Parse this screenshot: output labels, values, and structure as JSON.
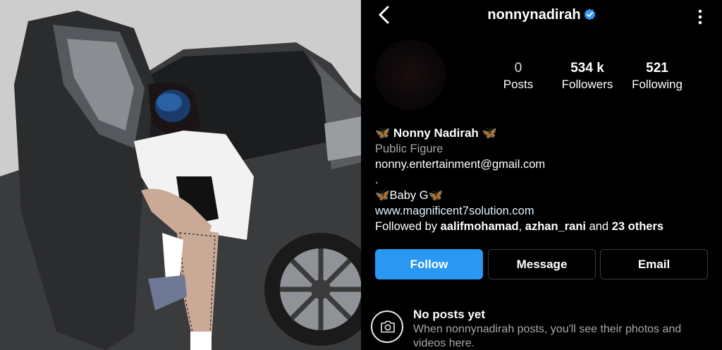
{
  "header": {
    "username": "nonnynadirah",
    "back_icon": "chevron-left-icon",
    "verified_icon": "verified-badge-icon",
    "more_icon": "more-vertical-icon"
  },
  "stats": {
    "posts": {
      "value": "0",
      "label": "Posts"
    },
    "followers": {
      "value": "534 k",
      "label": "Followers"
    },
    "following": {
      "value": "521",
      "label": "Following"
    }
  },
  "bio": {
    "name": "Nonny Nadirah",
    "name_emoji": "🦋",
    "category": "Public Figure",
    "email": "nonny.entertainment@gmail.com",
    "dot": ".",
    "baby_line_emoji": "🦋",
    "baby_line_text": "Baby G",
    "website": "www.magnificent7solution.com",
    "followed_by_prefix": "Followed by",
    "followed_user_1": "aalifmohamad",
    "separator": ",",
    "followed_user_2": "azhan_rani",
    "followed_and": "and",
    "followed_others": "23 others"
  },
  "actions": {
    "follow": "Follow",
    "message": "Message",
    "email": "Email"
  },
  "empty_state": {
    "icon": "camera-icon",
    "title": "No posts yet",
    "subtitle": "When nonnynadirah posts, you'll see their photos and videos here."
  },
  "colors": {
    "background": "#000000",
    "accent_blue": "#2a97f2",
    "secondary_text": "#a8a8a8",
    "verified_blue": "#3897f0"
  }
}
